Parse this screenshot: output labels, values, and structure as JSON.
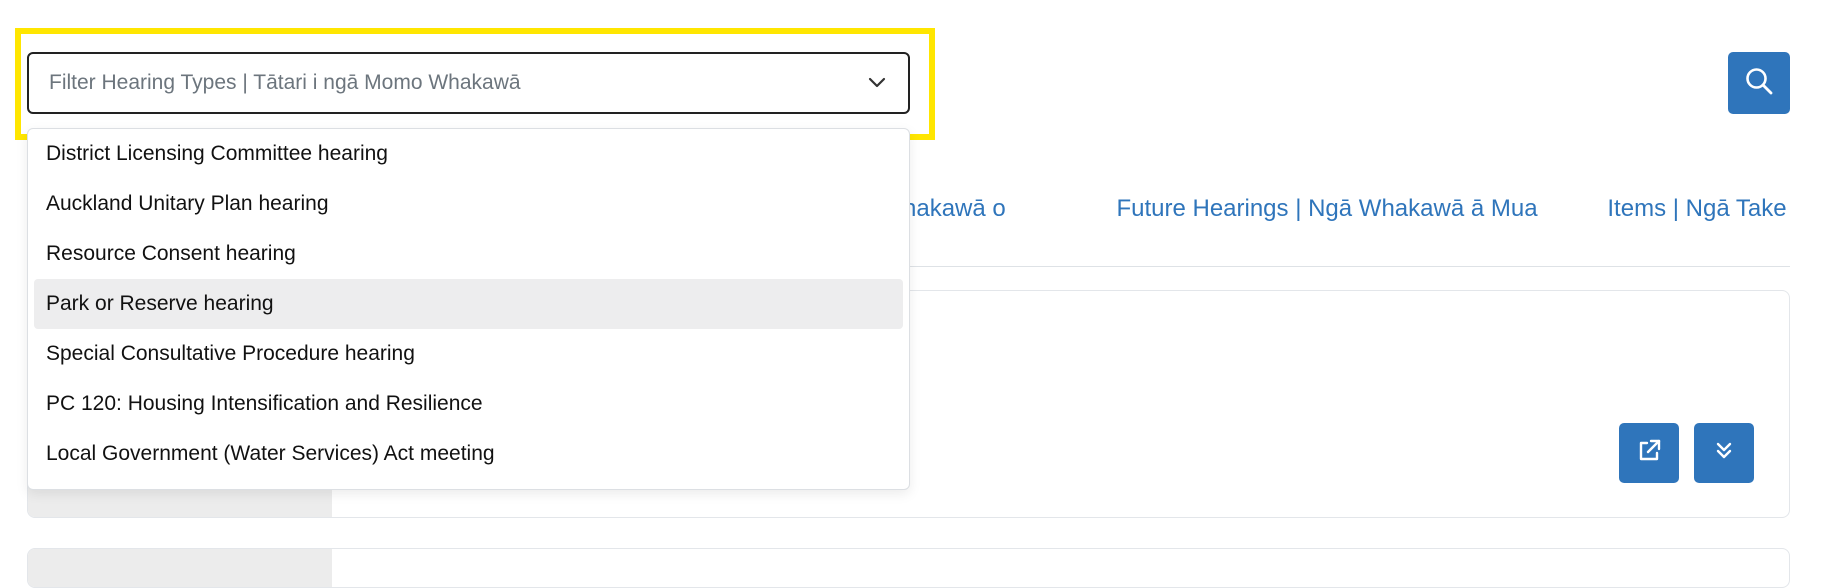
{
  "filter": {
    "placeholder": "Filter Hearing Types | Tātari i ngā Momo Whakawā",
    "options": [
      {
        "label": "District Licensing Committee hearing"
      },
      {
        "label": "Auckland Unitary Plan hearing"
      },
      {
        "label": "Resource Consent hearing"
      },
      {
        "label": "Park or Reserve hearing"
      },
      {
        "label": "Special Consultative Procedure hearing"
      },
      {
        "label": "PC 120: Housing Intensification and Resilience"
      },
      {
        "label": "Local Government (Water Services) Act meeting"
      }
    ],
    "highlighted_option": "Park or Reserve hearing"
  },
  "tabs": [
    {
      "label": "Vhakawā o"
    },
    {
      "label": "Future Hearings | Ngā Whakawā ā Mua"
    },
    {
      "label": "Items | Ngā Take"
    }
  ],
  "icons": {
    "dropdown": "chevron-down-icon",
    "search": "search-icon",
    "open": "external-link-icon",
    "expand": "double-chevron-down-icon"
  },
  "colors": {
    "accent": "#2f75bb",
    "highlight_border": "#ffe600",
    "option_hover": "#ededee"
  }
}
